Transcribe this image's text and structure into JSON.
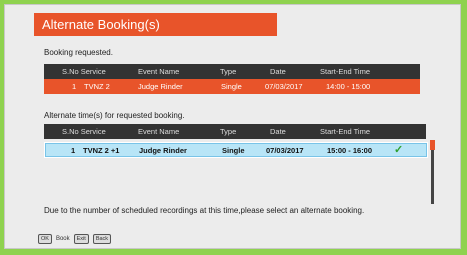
{
  "title": "Alternate Booking(s)",
  "requested_label": "Booking requested.",
  "alternate_label": "Alternate time(s) for requested booking.",
  "columns": {
    "sno_service": "S.No Service",
    "event_name": "Event Name",
    "type": "Type",
    "date": "Date",
    "time": "Start-End Time"
  },
  "requested_row": {
    "sno": "1",
    "service": "TVNZ 2",
    "event": "Judge Rinder",
    "type": "Single",
    "date": "07/03/2017",
    "time": "14:00 - 15:00"
  },
  "alternate_row": {
    "sno": "1",
    "service": "TVNZ 2 +1",
    "event": "Judge Rinder",
    "type": "Single",
    "date": "07/03/2017",
    "time": "15:00 - 16:00",
    "check": "✓"
  },
  "message": "Due to the number of scheduled recordings at this time,please select an alternate booking.",
  "footer": {
    "ok_key": "OK",
    "ok_label": "Book",
    "exit_key": "Exit",
    "back_key": "Back"
  }
}
